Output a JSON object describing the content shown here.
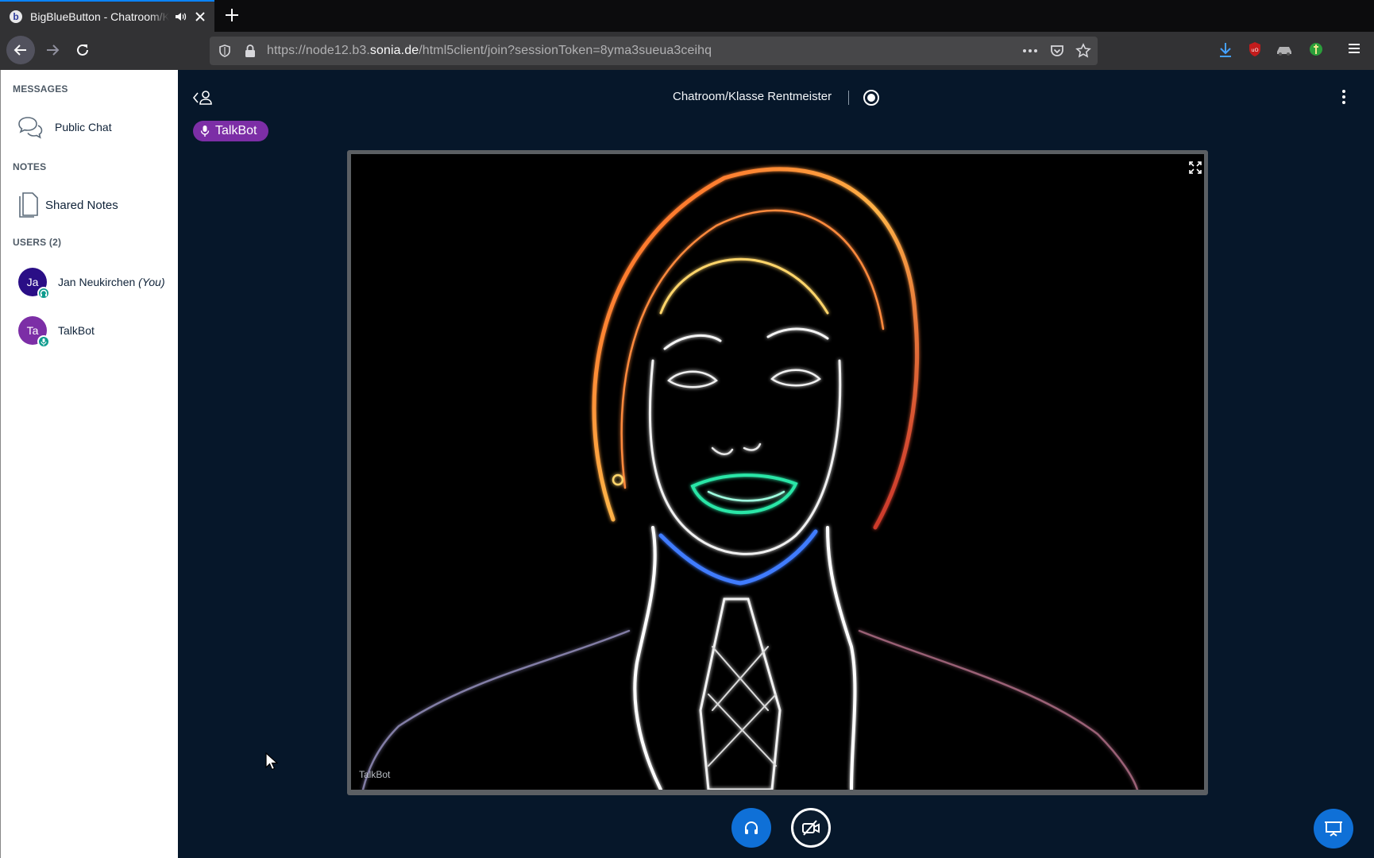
{
  "browser": {
    "tab_title": "BigBlueButton - Chatroom/Klasse Rentmeister",
    "url_prefix": "https://node12.b3.",
    "url_host": "sonia.de",
    "url_path": "/html5client/join?sessionToken=8yma3sueua3ceihq"
  },
  "sidebar": {
    "messages_header": "MESSAGES",
    "public_chat": "Public Chat",
    "notes_header": "NOTES",
    "shared_notes": "Shared Notes",
    "users_header": "USERS (2)",
    "users": [
      {
        "initials": "Ja",
        "name": "Jan Neukirchen",
        "suffix": "(You)",
        "avatar_color": "#2a0e86",
        "badge_icon": "headset-icon"
      },
      {
        "initials": "Ta",
        "name": "TalkBot",
        "suffix": "",
        "avatar_color": "#7c2ea6",
        "badge_icon": "microphone-icon"
      }
    ]
  },
  "main": {
    "room_title": "Chatroom/Klasse Rentmeister",
    "talking_indicator": "TalkBot",
    "video_user": "TalkBot"
  },
  "colors": {
    "accent": "#0f70d7",
    "background": "#06172a",
    "talker": "#7c2ea6"
  }
}
